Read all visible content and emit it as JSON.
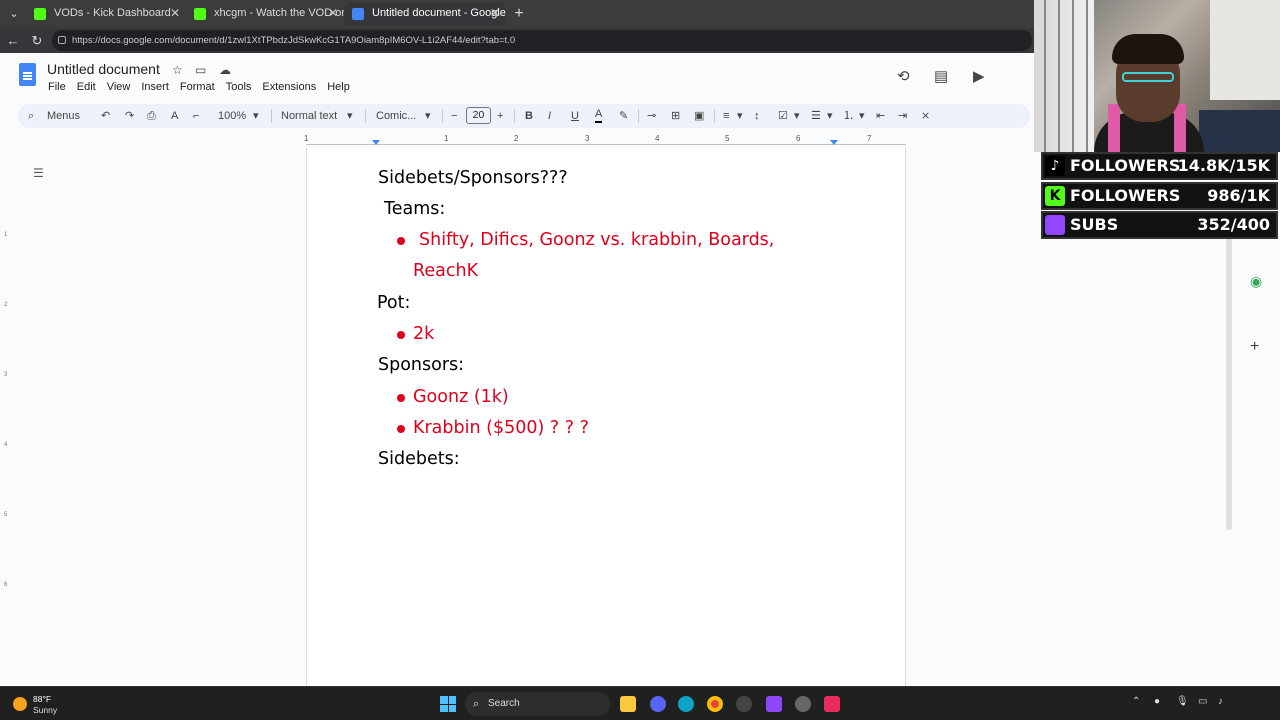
{
  "browser": {
    "tabs": [
      {
        "title": "VODs - Kick Dashboard",
        "favicon_color": "#53fc18"
      },
      {
        "title": "xhcgm - Watch the VOD on Kick",
        "favicon_color": "#53fc18"
      },
      {
        "title": "Untitled document - Google Docs",
        "favicon_color": "#4285f4"
      }
    ],
    "url": "https://docs.google.com/document/d/1zwl1XtTPbdzJdSkwKcG1TA9Oiam8pIM6OV-L1i2AF44/edit?tab=t.0"
  },
  "docs": {
    "title": "Untitled document",
    "menu": [
      "File",
      "Edit",
      "View",
      "Insert",
      "Format",
      "Tools",
      "Extensions",
      "Help"
    ],
    "toolbar": {
      "search_label": "Menus",
      "zoom": "100%",
      "style": "Normal text",
      "font": "Comic...",
      "font_size": "20"
    },
    "ruler_numbers": [
      "1",
      "1",
      "2",
      "3",
      "4",
      "5",
      "6",
      "7"
    ],
    "vruler_numbers": [
      "1",
      "2",
      "3",
      "4",
      "5",
      "6"
    ]
  },
  "document": {
    "heading": "Sidebets/Sponsors???",
    "teams_label": "Teams:",
    "teams_line1": "Shifty, Difics, Goonz vs. krabbin, Boards,",
    "teams_line2": "ReachK",
    "pot_label": "Pot:",
    "pot_value": "2k",
    "sponsors_label": "Sponsors:",
    "sponsor1": "Goonz (1k)",
    "sponsor2": "Krabbin ($500) ? ? ?",
    "sidebets_label": "Sidebets:"
  },
  "stream_overlay": {
    "stats": [
      {
        "label": "FOLLOWERS",
        "value": "14.8K/15K",
        "icon_color": "#000000",
        "icon": "tiktok-icon"
      },
      {
        "label": "FOLLOWERS",
        "value": "986/1K",
        "icon_color": "#53fc18",
        "icon": "kick-icon"
      },
      {
        "label": "SUBS",
        "value": "352/400",
        "icon_color": "#9146ff",
        "icon": "twitch-icon"
      }
    ]
  },
  "taskbar": {
    "weather_temp": "88°F",
    "weather_desc": "Sunny",
    "search_label": "Search"
  },
  "colors": {
    "accent": "#4285f4",
    "doc_red": "#e0001b"
  }
}
